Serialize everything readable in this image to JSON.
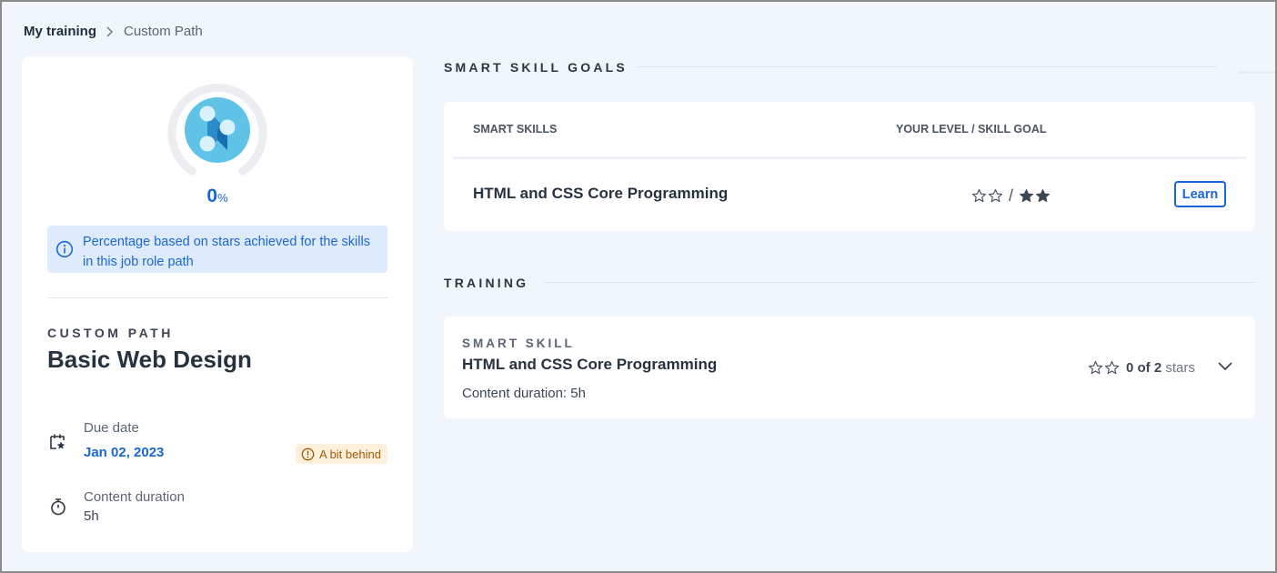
{
  "breadcrumb": {
    "root": "My training",
    "separator": "›",
    "current": "Custom Path"
  },
  "progress": {
    "value": "0",
    "unit": "%",
    "fraction": 0.0
  },
  "info": {
    "text": "Percentage based on stars achieved for the skills in this job role path",
    "icon": "info-icon"
  },
  "path": {
    "type": "CUSTOM PATH",
    "name": "Basic Web Design"
  },
  "due": {
    "label": "Due date",
    "value": "Jan 02, 2023",
    "status": "A bit behind",
    "icon": "calendar-star-icon"
  },
  "duration": {
    "label": "Content duration",
    "value": "5h",
    "icon": "stopwatch-icon"
  },
  "goals": {
    "title": "SMART SKILL GOALS",
    "col_skills": "SMART SKILLS",
    "col_level": "YOUR LEVEL / SKILL GOAL",
    "rows": [
      {
        "skill": "HTML and CSS Core Programming",
        "your_level": 0,
        "goal": 2,
        "max_stars": 2,
        "slash": "/",
        "action": "Learn"
      }
    ]
  },
  "training": {
    "title": "TRAINING",
    "items": [
      {
        "type": "SMART SKILL",
        "name": "HTML and CSS Core Programming",
        "duration": "Content duration: 5h",
        "stars_earned": "0",
        "stars_total": "2",
        "of_text": "of",
        "stars_word": "stars"
      }
    ]
  },
  "colors": {
    "accent": "#1a66d6",
    "warning_bg": "#fdf0dc",
    "warning_text": "#a35a06",
    "info_bg": "#deebfd"
  }
}
